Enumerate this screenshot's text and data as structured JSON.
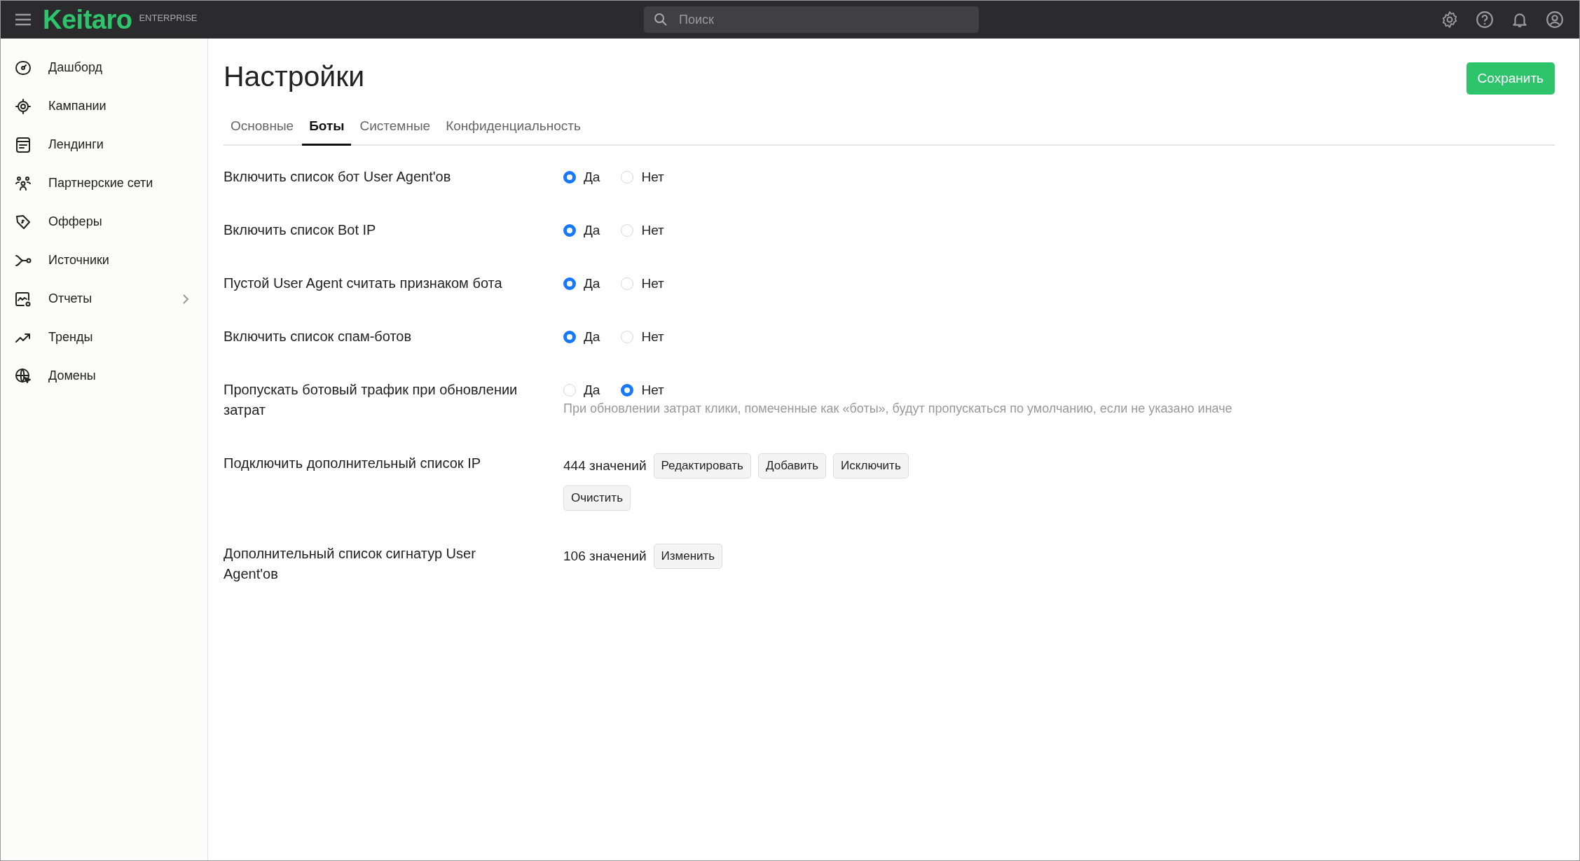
{
  "topbar": {
    "logo": "Keitaro",
    "edition": "ENTERPRISE",
    "search": {
      "placeholder": "Поиск"
    }
  },
  "sidebar": {
    "items": [
      {
        "label": "Дашборд",
        "expandable": false
      },
      {
        "label": "Кампании",
        "expandable": false
      },
      {
        "label": "Лендинги",
        "expandable": false
      },
      {
        "label": "Партнерские сети",
        "expandable": false
      },
      {
        "label": "Офферы",
        "expandable": false
      },
      {
        "label": "Источники",
        "expandable": false
      },
      {
        "label": "Отчеты",
        "expandable": true
      },
      {
        "label": "Тренды",
        "expandable": false
      },
      {
        "label": "Домены",
        "expandable": false
      }
    ]
  },
  "page": {
    "title": "Настройки",
    "save_button": "Сохранить",
    "tabs": [
      {
        "label": "Основные",
        "selected": false
      },
      {
        "label": "Боты",
        "selected": true
      },
      {
        "label": "Системные",
        "selected": false
      },
      {
        "label": "Конфиденциальность",
        "selected": false
      }
    ],
    "settings": [
      {
        "kind": "radio",
        "label": "Включить список бот User Agent'ов",
        "options": [
          {
            "label": "Да",
            "selected": true
          },
          {
            "label": "Нет",
            "selected": false
          }
        ]
      },
      {
        "kind": "radio",
        "label": "Включить список Bot IP",
        "options": [
          {
            "label": "Да",
            "selected": true
          },
          {
            "label": "Нет",
            "selected": false
          }
        ]
      },
      {
        "kind": "radio",
        "label": "Пустой User Agent считать признаком бота",
        "options": [
          {
            "label": "Да",
            "selected": true
          },
          {
            "label": "Нет",
            "selected": false
          }
        ]
      },
      {
        "kind": "radio",
        "label": "Включить список спам-ботов",
        "options": [
          {
            "label": "Да",
            "selected": true
          },
          {
            "label": "Нет",
            "selected": false
          }
        ]
      },
      {
        "kind": "radio",
        "label": "Пропускать ботовый трафик при обновлении затрат",
        "options": [
          {
            "label": "Да",
            "selected": false
          },
          {
            "label": "Нет",
            "selected": true
          }
        ],
        "hint": "При обновлении затрат клики, помеченные как «боты», будут пропускаться по умолчанию, если не указано иначе"
      },
      {
        "kind": "list",
        "label": "Подключить дополнительный список IP",
        "count": "444 значений",
        "buttons": [
          "Редактировать",
          "Добавить",
          "Исключить",
          "Очистить"
        ]
      },
      {
        "kind": "list",
        "label": "Дополнительный список сигнатур User Agent'ов",
        "count": "106 значений",
        "buttons": [
          "Изменить"
        ]
      }
    ]
  }
}
